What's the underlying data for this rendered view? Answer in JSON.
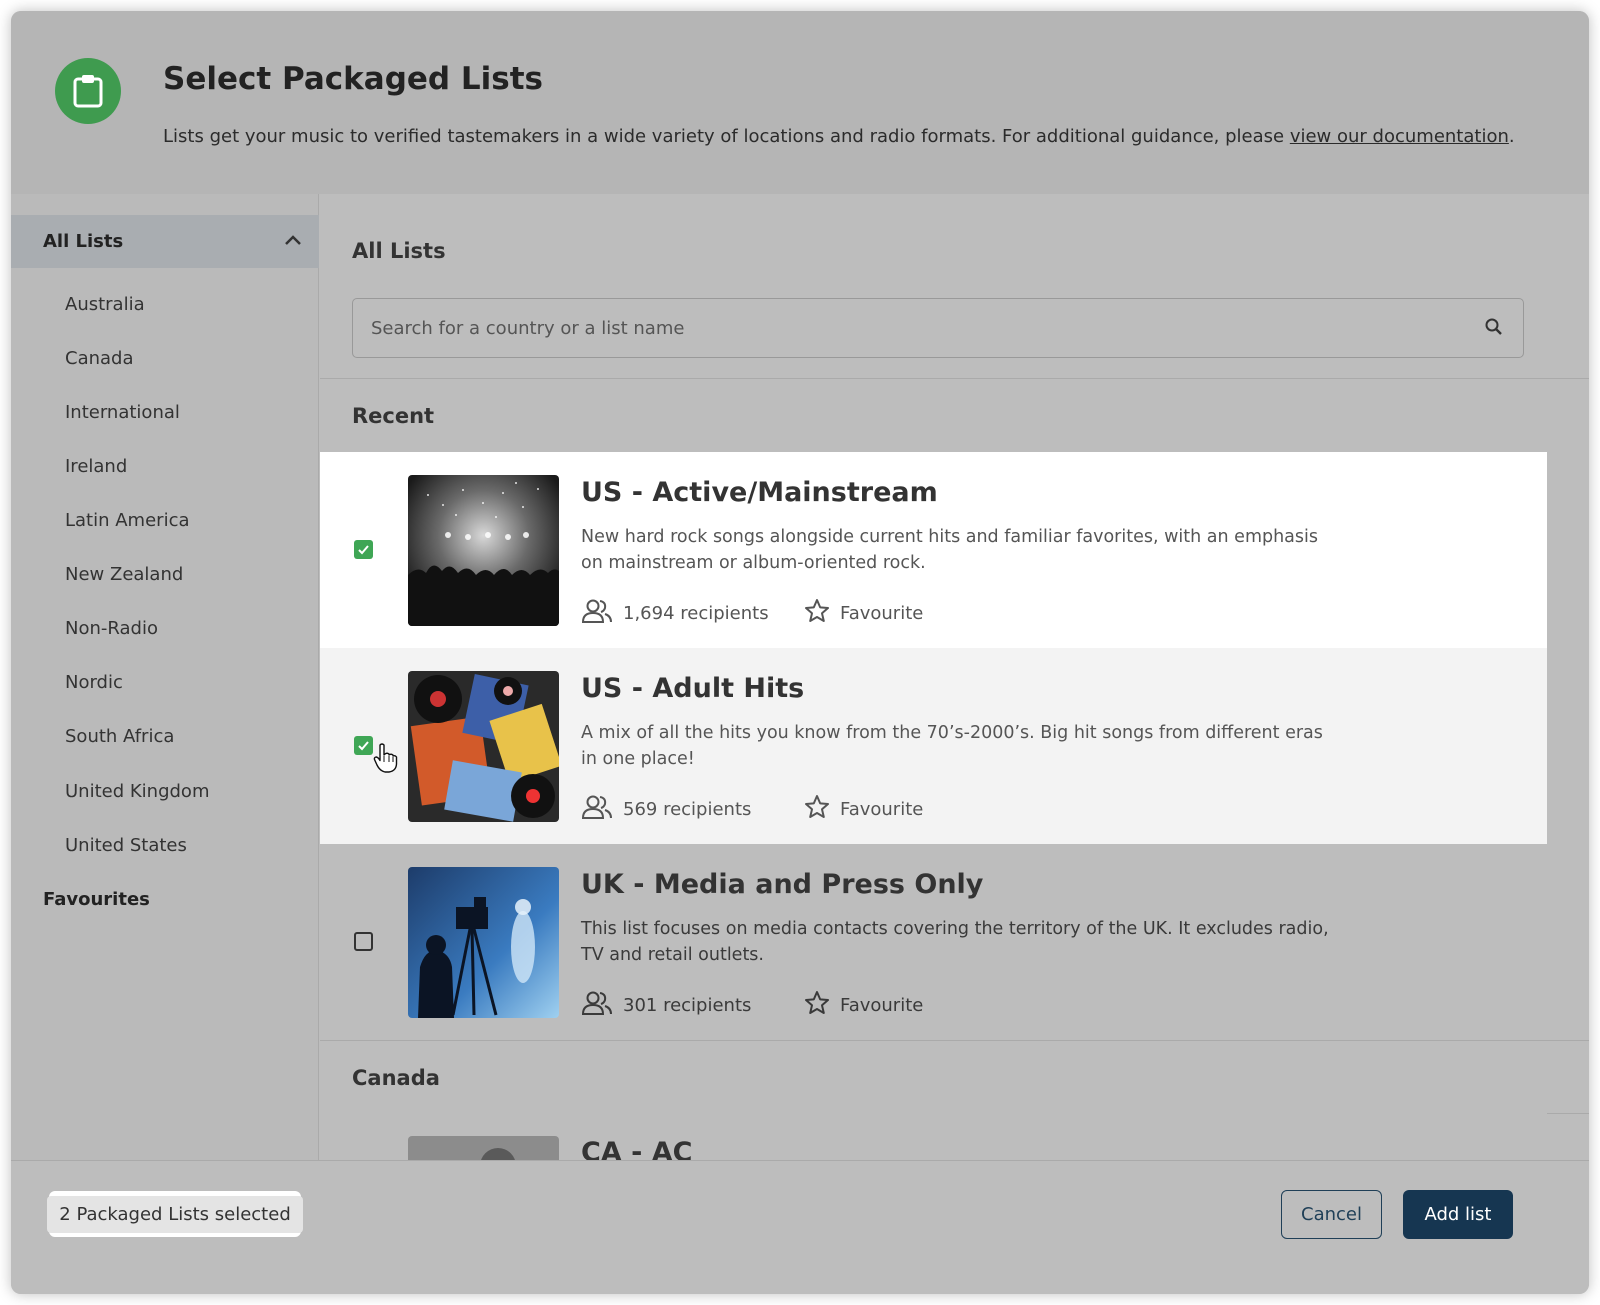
{
  "header": {
    "title": "Select Packaged Lists",
    "subtitle": "Lists get your music to verified tastemakers in a wide variety of locations and radio formats. For additional guidance, please ",
    "link": "view our documentation",
    "period": "."
  },
  "sidebar": {
    "header": "All Lists",
    "items": [
      "Australia",
      "Canada",
      "International",
      "Ireland",
      "Latin America",
      "New Zealand",
      "Non-Radio",
      "Nordic",
      "South Africa",
      "United Kingdom",
      "United States"
    ],
    "favourites": "Favourites"
  },
  "main": {
    "title": "All Lists",
    "search_placeholder": "Search for a country or a list name",
    "sections": {
      "recent": "Recent",
      "canada": "Canada"
    }
  },
  "lists": [
    {
      "title": "US - Active/Mainstream",
      "description": "New hard rock songs alongside current hits and familiar favorites, with an emphasis on mainstream or album-oriented rock.",
      "recipients": "1,694 recipients",
      "favourite": "Favourite",
      "checked": true
    },
    {
      "title": "US - Adult Hits",
      "description": "A mix of all the hits you know from the 70’s-2000’s. Big hit songs from different eras in one place!",
      "recipients": "569 recipients",
      "favourite": "Favourite",
      "checked": true
    },
    {
      "title": "UK - Media and Press Only",
      "description": "This list focuses on media contacts covering the territory of the UK. It excludes radio, TV and retail outlets.",
      "recipients": "301 recipients",
      "favourite": "Favourite",
      "checked": false
    },
    {
      "title": "CA - AC"
    }
  ],
  "footer": {
    "selected": "2 Packaged Lists selected",
    "cancel": "Cancel",
    "add": "Add list"
  },
  "colors": {
    "accent_green": "#3f9b4f",
    "primary_button": "#163651"
  }
}
